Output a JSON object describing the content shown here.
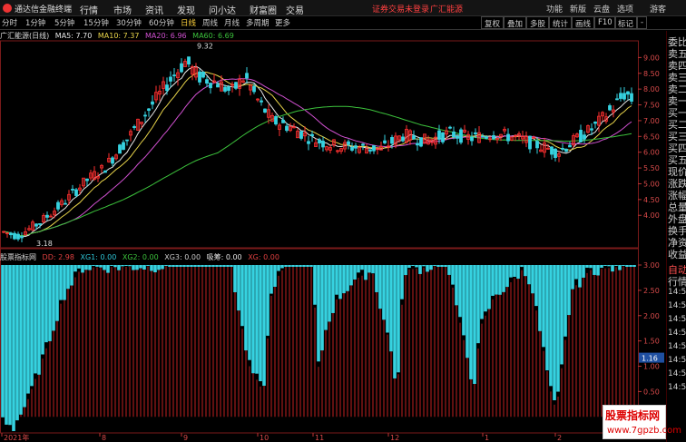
{
  "app": {
    "title": "通达信金融终端"
  },
  "menu": [
    "行情",
    "市场",
    "资讯",
    "发现",
    "问小达",
    "财富圈",
    "交易"
  ],
  "status": {
    "login_text": "证券交易未登录",
    "broker": "广汇能源"
  },
  "right_menu": [
    "功能",
    "新版",
    "云盘",
    "选项",
    "游客"
  ],
  "window_buttons": [
    "—",
    "□",
    "✕"
  ],
  "toolbar": {
    "periods": [
      "分时",
      "1分钟",
      "5分钟",
      "15分钟",
      "30分钟",
      "60分钟",
      "日线",
      "周线",
      "月线",
      "多周期",
      "更多"
    ],
    "active_period": "日线",
    "right": [
      "复权",
      "叠加",
      "多股",
      "统计",
      "画线",
      "F10",
      "标记",
      "-"
    ]
  },
  "stock_title": "广汇能源(日线)",
  "ma": [
    {
      "label": "MA5: 7.70",
      "color": "#e8e8e8"
    },
    {
      "label": "MA10: 7.37",
      "color": "#e8d44a"
    },
    {
      "label": "MA20: 6.96",
      "color": "#d050d0"
    },
    {
      "label": "MA60: 6.69",
      "color": "#3cc23c"
    }
  ],
  "indicator": {
    "title": "股票指标网",
    "items": [
      {
        "label": "DD: 2.98",
        "color": "#e04040"
      },
      {
        "label": "XG1: 0.00",
        "color": "#2fc7d8"
      },
      {
        "label": "XG2: 0.00",
        "color": "#3cc23c"
      },
      {
        "label": "XG3: 0.00",
        "color": "#cccccc"
      },
      {
        "label": "吸筹: 0.00",
        "color": "#e8e8e8"
      },
      {
        "label": "XG: 0.00",
        "color": "#e04040"
      }
    ],
    "value_box": "1.16"
  },
  "side_panel": [
    "委比",
    "卖五",
    "卖四",
    "卖三",
    "卖二",
    "卖一",
    "买一",
    "买二",
    "买三",
    "买四",
    "买五",
    "现价",
    "涨跌",
    "涨幅",
    "总量",
    "外盘",
    "换手",
    "净资",
    "收益",
    "自动",
    "行情",
    "14:56",
    "14:56",
    "14:56",
    "14:56",
    "14:56",
    "14:56",
    "14:56",
    "14:56"
  ],
  "price_axis": [
    "9.00",
    "8.50",
    "8.00",
    "7.50",
    "7.00",
    "6.50",
    "6.00",
    "5.50",
    "5.00",
    "4.50",
    "4.00"
  ],
  "indicator_axis": [
    "3.00",
    "2.50",
    "2.00",
    "1.50",
    "1.00",
    "0.50"
  ],
  "date_axis": [
    "2021年",
    "8",
    "9",
    "10",
    "11",
    "12",
    "1",
    "2"
  ],
  "annotations": {
    "high": "9.32",
    "low": "3.18"
  },
  "watermark": {
    "title": "股票指标网",
    "url": "www.7gpzb.com"
  }
}
